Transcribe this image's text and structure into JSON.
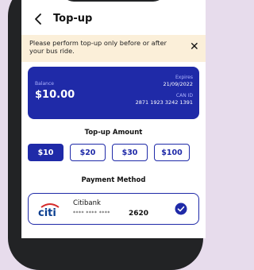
{
  "header": {
    "title": "Top-up"
  },
  "notice": {
    "text": "Please perform top-up only before or after your bus ride."
  },
  "card": {
    "balance_label": "Balance",
    "balance_value": "$10.00",
    "expires_label": "Expires",
    "expires_value": "21/09/2022",
    "can_label": "CAN ID",
    "can_value": "2871 1923 3242 1391",
    "color": "#1f2aa8"
  },
  "topup": {
    "title": "Top-up Amount",
    "amounts": [
      "$10",
      "$20",
      "$30",
      "$100"
    ],
    "selected": "$10"
  },
  "payment": {
    "title": "Payment Method",
    "bank_logo_text": "citi",
    "bank_name": "Citibank",
    "masked": "**** **** ****",
    "last4": "2620",
    "selected": true
  },
  "icons": {
    "back": "chevron-left-icon",
    "close": "close-icon",
    "check": "check-circle-icon"
  }
}
